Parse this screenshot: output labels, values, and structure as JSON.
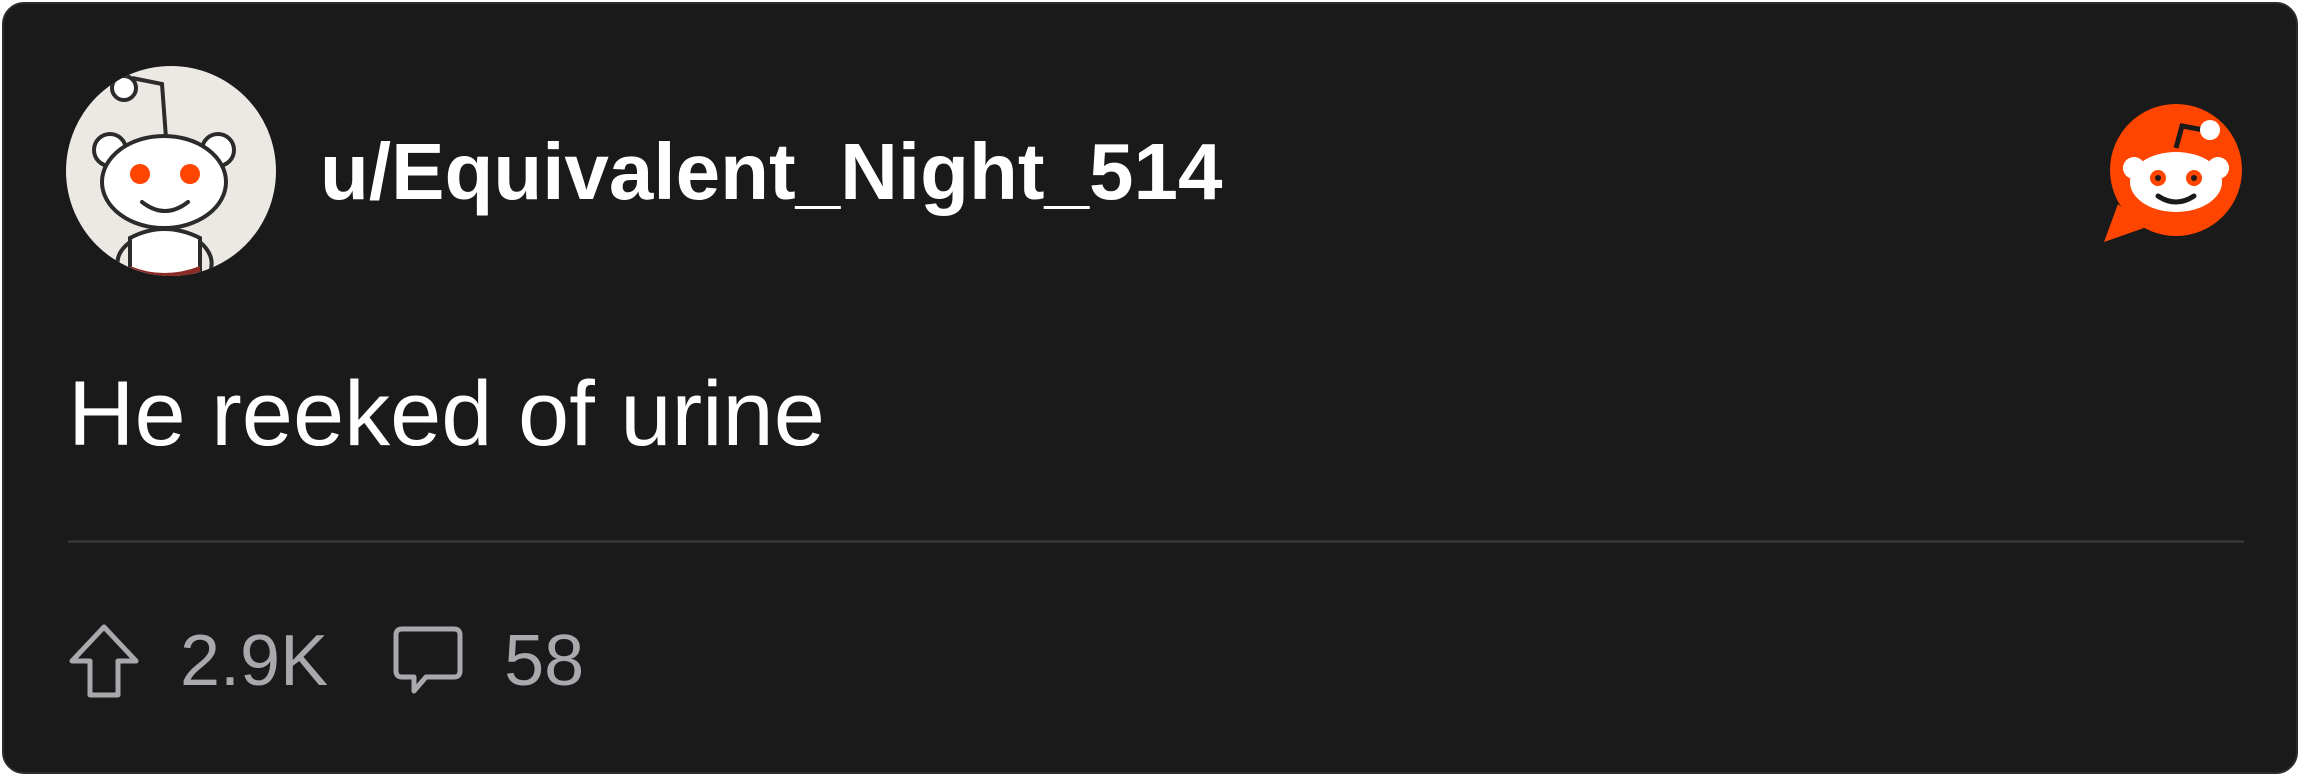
{
  "post": {
    "username": "u/Equivalent_Night_514",
    "body": "He reeked of urine",
    "upvotes": "2.9K",
    "comments": "58"
  },
  "icons": {
    "avatar": "snoo-avatar-icon",
    "brand": "reddit-logo-icon",
    "upvote": "upvote-arrow-icon",
    "comment": "comment-bubble-icon"
  },
  "colors": {
    "card_background": "#1a1a1b",
    "brand_orange": "#ff4500",
    "text_primary": "#ffffff",
    "text_secondary": "#a9a9ad"
  }
}
